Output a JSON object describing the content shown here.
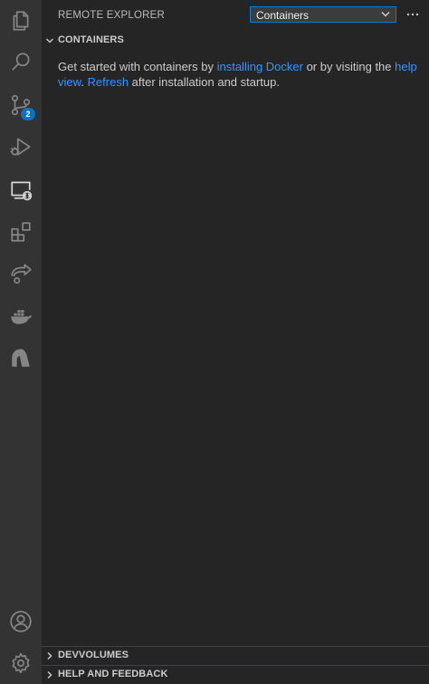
{
  "activity_bar": {
    "items": [
      {
        "name": "explorer",
        "icon": "files-icon"
      },
      {
        "name": "search",
        "icon": "search-icon"
      },
      {
        "name": "source-control",
        "icon": "source-control-icon",
        "badge": "2"
      },
      {
        "name": "run-and-debug",
        "icon": "run-debug-icon"
      },
      {
        "name": "remote-explorer",
        "icon": "remote-explorer-icon",
        "active": true
      },
      {
        "name": "extensions",
        "icon": "extensions-icon"
      },
      {
        "name": "live-share",
        "icon": "live-share-icon"
      },
      {
        "name": "docker",
        "icon": "docker-icon"
      },
      {
        "name": "extension-app",
        "icon": "app-logo-icon"
      }
    ],
    "bottom": [
      {
        "name": "accounts",
        "icon": "account-icon"
      },
      {
        "name": "manage",
        "icon": "gear-icon"
      }
    ]
  },
  "sidebar": {
    "title": "REMOTE EXPLORER",
    "dropdown_value": "Containers",
    "more_label": "...",
    "sections": {
      "containers": "CONTAINERS",
      "devvolumes": "DEVVOLUMES",
      "help": "HELP AND FEEDBACK"
    },
    "welcome": {
      "part1": "Get started with containers by ",
      "link1": "installing Docker",
      "part2": " or by visiting the ",
      "link2": "help view",
      "part3": ". ",
      "link3": "Refresh",
      "part4": " after installation and startup."
    }
  },
  "colors": {
    "activity_bar_bg": "#333333",
    "sidebar_bg": "#252526",
    "link": "#3794ff",
    "badge": "#0e70c0",
    "focus_border": "#007fd4"
  }
}
